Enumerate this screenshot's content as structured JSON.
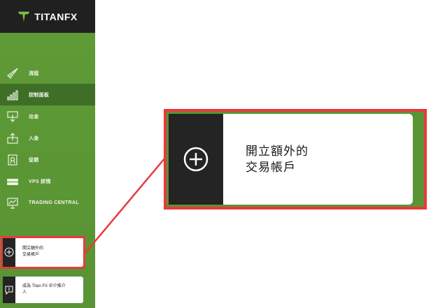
{
  "brand": {
    "logo_text": "TITANFX",
    "accent": "#5b9635",
    "highlight": "#e8393f"
  },
  "nav": {
    "items": [
      {
        "label": "流程",
        "icon": "rocket-icon"
      },
      {
        "label": "控制面板",
        "icon": "bar-chart-icon"
      },
      {
        "label": "出金",
        "icon": "withdraw-icon"
      },
      {
        "label": "入金",
        "icon": "deposit-icon"
      },
      {
        "label": "促銷",
        "icon": "promotion-icon"
      },
      {
        "label": "VPS 詳情",
        "icon": "server-icon"
      },
      {
        "label": "TRADING CENTRAL",
        "icon": "chart-board-icon"
      }
    ]
  },
  "cta": {
    "open_account_line1": "開立額外的",
    "open_account_line2": "交易帳戶",
    "partner_line1": "成為 Titan FX 中介推介",
    "partner_line2": "人"
  },
  "zoom": {
    "line1": "開立額外的",
    "line2": "交易帳戶"
  }
}
